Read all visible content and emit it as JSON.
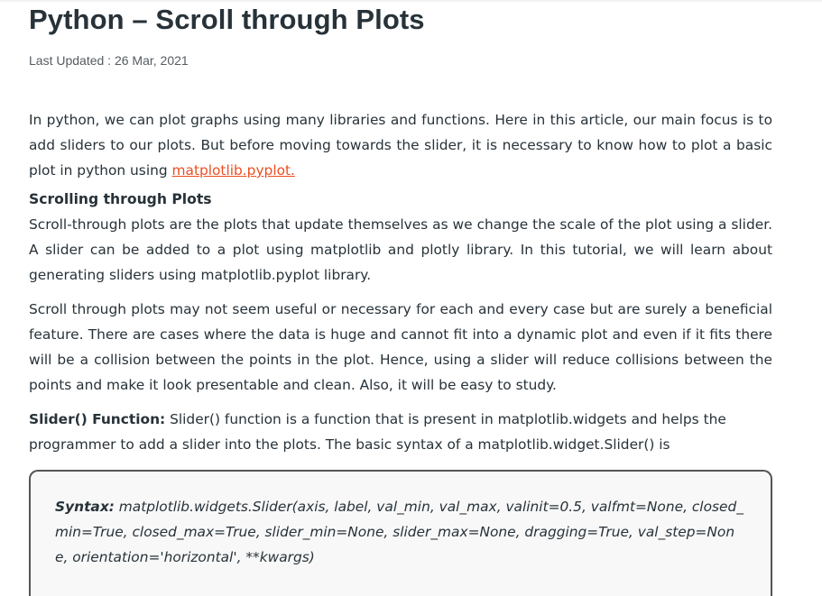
{
  "article": {
    "title": "Python – Scroll through Plots",
    "last_updated": "Last Updated : 26 Mar, 2021",
    "intro_text": "In python, we can plot graphs using many libraries and functions. Here in this article, our main focus is to add sliders to our plots. But before moving towards the slider, it is necessary to know how to plot a basic plot in python using ",
    "intro_link": "matplotlib.pyplot.",
    "subheading": "Scrolling through Plots",
    "para2": "Scroll-through plots are the plots that update themselves as we change the scale of the plot using a slider. A slider can be added to a plot using matplotlib and plotly library. In this tutorial, we will learn about generating sliders using matplotlib.pyplot library.",
    "para3": "Scroll through plots may not seem useful or necessary for each and every case but are surely a beneficial feature. There are cases where the data is huge and cannot fit into a dynamic plot and even if it fits there will be a collision between the points in the plot. Hence, using a slider will reduce collisions between the points and make it look presentable and clean. Also, it will be easy to study.",
    "slider_lead": "Slider() Function:",
    "slider_text": " Slider() function is a function that is present in matplotlib.widgets and helps the programmer to add a slider into the plots. The basic syntax of a matplotlib.widget.Slider() is",
    "syntax_label": "Syntax:",
    "syntax_code": " matplotlib.widgets.Slider(axis, label, val_min, val_max, valinit=0.5, valfmt=None, closed_min=True, closed_max=True, slider_min=None, slider_max=None, dragging=True, val_step=None, orientation='horizontal',  **kwargs)"
  },
  "colors": {
    "text": "#273239",
    "link": "#ec4e20",
    "code_bg": "#f8f8f8",
    "code_border": "#555555"
  }
}
